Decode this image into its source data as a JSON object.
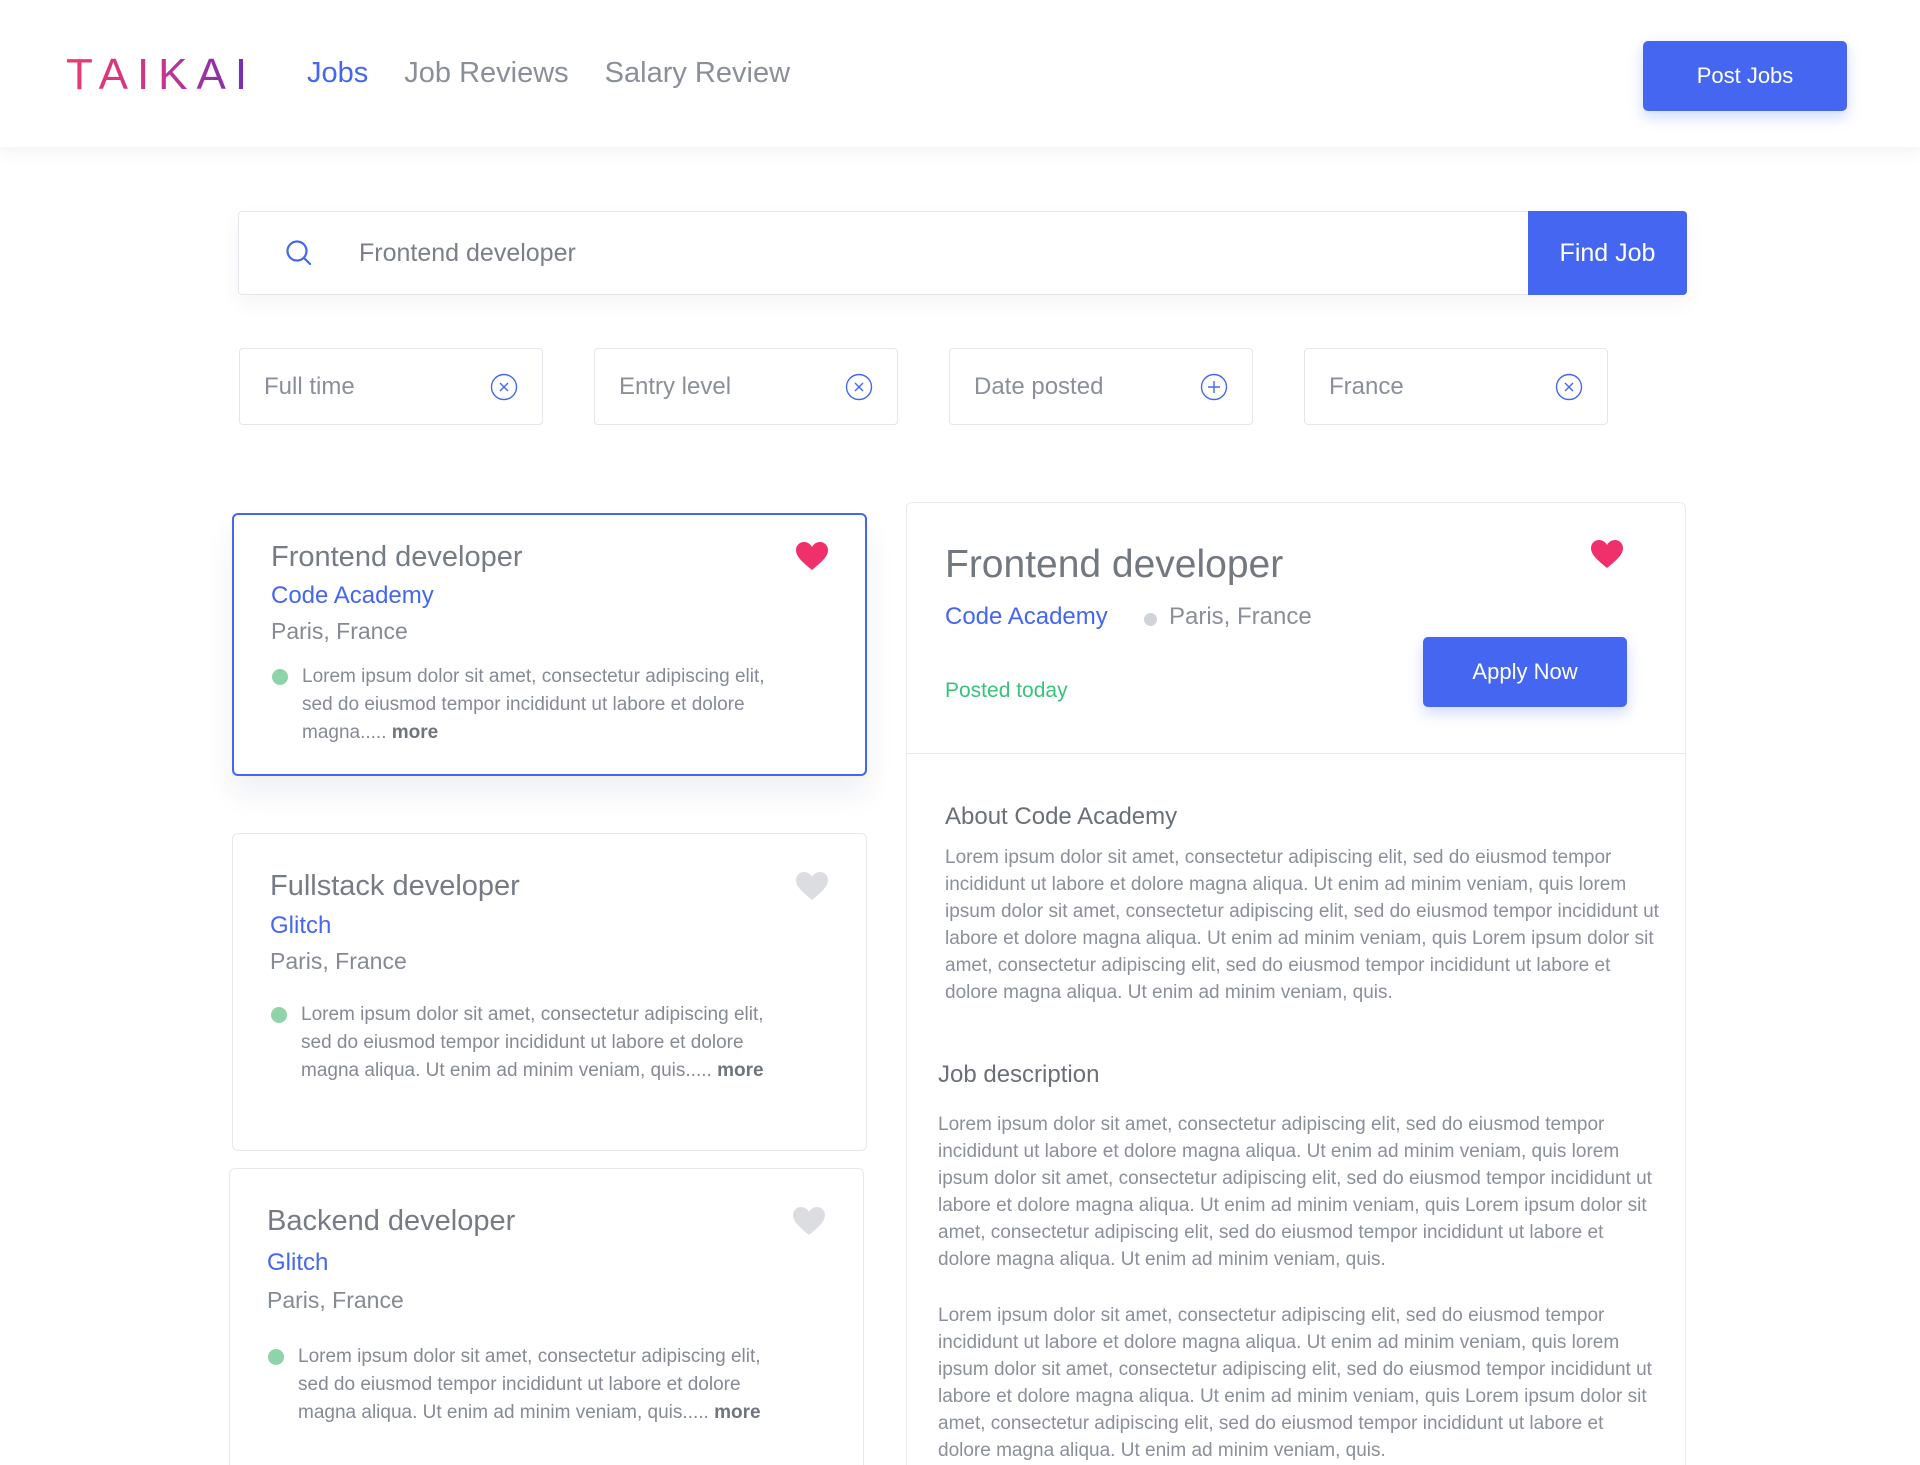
{
  "header": {
    "logo_text": "TAIKAI",
    "nav": [
      {
        "label": "Jobs",
        "active": true
      },
      {
        "label": "Job Reviews",
        "active": false
      },
      {
        "label": "Salary Review",
        "active": false
      }
    ],
    "post_button": "Post Jobs"
  },
  "search": {
    "query": "Frontend developer",
    "button": "Find Job"
  },
  "filters": [
    {
      "label": "Full time",
      "control": "clear-icon"
    },
    {
      "label": "Entry level",
      "control": "clear-icon"
    },
    {
      "label": "Date posted",
      "control": "add-icon"
    },
    {
      "label": "France",
      "control": "clear-icon"
    }
  ],
  "jobs": [
    {
      "title": "Frontend developer",
      "company": "Code Academy",
      "location": "Paris, France",
      "description": "Lorem ipsum dolor sit amet, consectetur adipiscing elit, sed do eiusmod tempor incididunt ut labore et dolore magna.....",
      "more": "more",
      "favorited": true
    },
    {
      "title": "Fullstack developer",
      "company": "Glitch",
      "location": "Paris, France",
      "description": "Lorem ipsum dolor sit amet, consectetur adipiscing elit, sed do eiusmod tempor incididunt ut labore et dolore magna aliqua. Ut enim ad minim veniam, quis.....",
      "more": "more",
      "favorited": false
    },
    {
      "title": "Backend developer",
      "company": "Glitch",
      "location": "Paris, France",
      "description": "Lorem ipsum dolor sit amet, consectetur adipiscing elit, sed do eiusmod tempor incididunt ut labore et dolore magna aliqua. Ut enim ad minim veniam, quis.....",
      "more": "more",
      "favorited": false
    }
  ],
  "detail": {
    "title": "Frontend developer",
    "company": "Code Academy",
    "location": "Paris, France",
    "posted": "Posted today",
    "apply_button": "Apply Now",
    "favorited": true,
    "about_heading": "About Code Academy",
    "about_text": "Lorem ipsum dolor sit amet, consectetur adipiscing elit, sed do eiusmod tempor incididunt ut labore et dolore magna aliqua. Ut enim ad minim veniam, quis lorem ipsum dolor sit amet, consectetur adipiscing elit, sed do eiusmod tempor incididunt ut labore et dolore magna aliqua. Ut enim ad minim veniam, quis Lorem ipsum dolor sit amet, consectetur adipiscing elit, sed do eiusmod tempor incididunt ut labore et dolore magna aliqua. Ut enim ad minim veniam, quis.",
    "description_heading": "Job description",
    "description_p1": "Lorem ipsum dolor sit amet, consectetur adipiscing elit, sed do eiusmod tempor incididunt ut labore et dolore magna aliqua. Ut enim ad minim veniam, quis lorem ipsum dolor sit amet, consectetur adipiscing elit, sed do eiusmod tempor incididunt ut labore et dolore magna aliqua. Ut enim ad minim veniam, quis Lorem ipsum dolor sit amet, consectetur adipiscing elit, sed do eiusmod tempor incididunt ut labore et dolore magna aliqua. Ut enim ad minim veniam, quis.",
    "description_p2": "Lorem ipsum dolor sit amet, consectetur adipiscing elit, sed do eiusmod tempor incididunt ut labore et dolore magna aliqua. Ut enim ad minim veniam, quis lorem ipsum dolor sit amet, consectetur adipiscing elit, sed do eiusmod tempor incididunt ut labore et dolore magna aliqua. Ut enim ad minim veniam, quis Lorem ipsum dolor sit amet, consectetur adipiscing elit, sed do eiusmod tempor incididunt ut labore et dolore magna aliqua. Ut enim ad minim veniam, quis."
  },
  "colors": {
    "accent": "#4566f0",
    "favorite": "#f0306a",
    "favorite_off": "#dcdde0",
    "status_dot": "#8fd4a8",
    "posted": "#3bc27a"
  }
}
